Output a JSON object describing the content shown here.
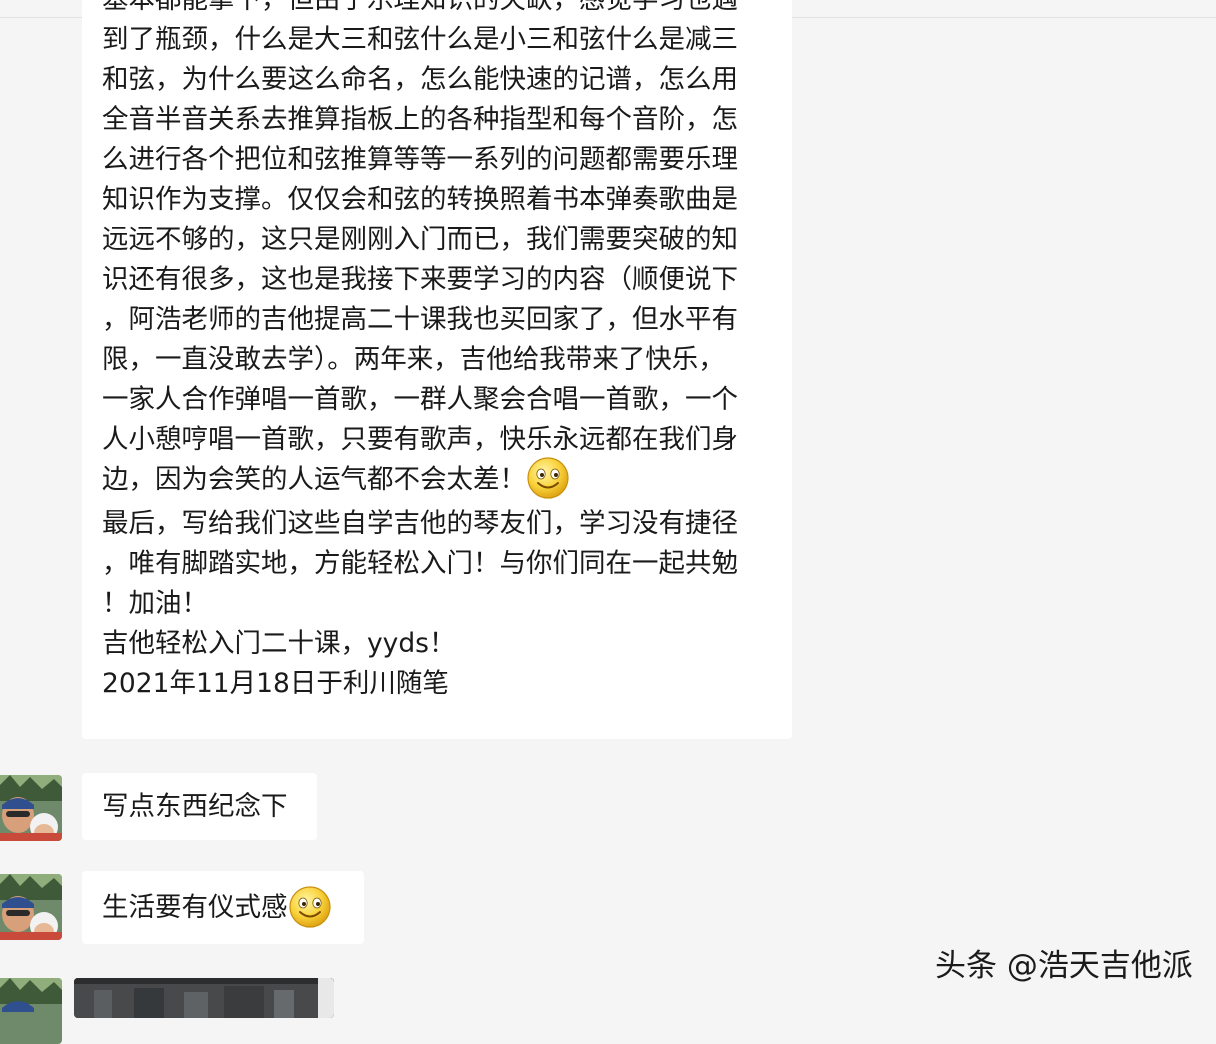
{
  "chat": {
    "long_message": {
      "lines": [
        "基本都能拿下，但由于乐理知识的欠缺，感觉学习也遇",
        "到了瓶颈，什么是大三和弦什么是小三和弦什么是减三",
        "和弦，为什么要这么命名，怎么能快速的记谱，怎么用",
        "全音半音关系去推算指板上的各种指型和每个音阶，怎",
        "么进行各个把位和弦推算等等一系列的问题都需要乐理",
        "知识作为支撑。仅仅会和弦的转换照着书本弹奏歌曲是",
        "远远不够的，这只是刚刚入门而已，我们需要突破的知",
        "识还有很多，这也是我接下来要学习的内容（顺便说下",
        "，阿浩老师的吉他提高二十课我也买回家了，但水平有",
        "限，一直没敢去学）。两年来，吉他给我带来了快乐，",
        "一家人合作弹唱一首歌，一群人聚会合唱一首歌，一个",
        "人小憩哼唱一首歌，只要有歌声，快乐永远都在我们身",
        "边，因为会笑的人运气都不会太差！",
        "最后，写给我们这些自学吉他的琴友们，学习没有捷径",
        "，唯有脚踏实地，方能轻松入门！与你们同在一起共勉",
        "！加油！",
        "吉他轻松入门二十课，yyds！",
        "2021年11月18日于利川随笔"
      ]
    },
    "msg_2": "写点东西纪念下",
    "msg_3": "生活要有仪式感",
    "emoji_icon": "smiley-emoji",
    "bubble_color": "#ffffff",
    "background_color": "#f5f5f5"
  },
  "watermark": "头条 @浩天吉他派"
}
